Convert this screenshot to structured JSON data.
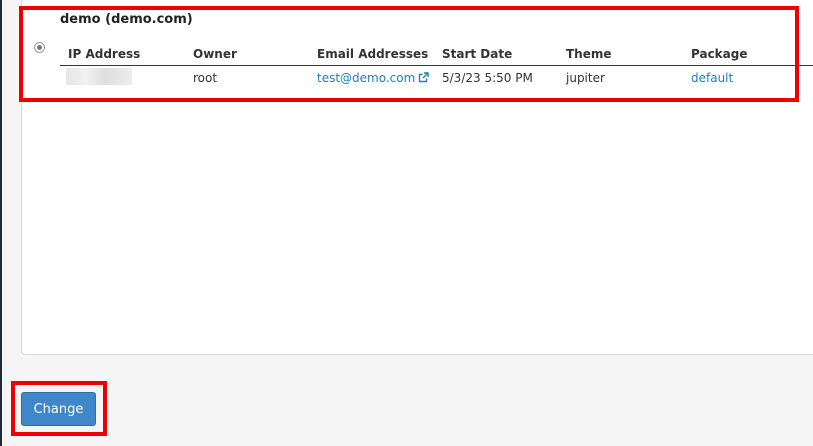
{
  "account": {
    "title": "demo (demo.com)",
    "selected": true
  },
  "table": {
    "headers": {
      "ip": "IP Address",
      "owner": "Owner",
      "email": "Email Addresses",
      "start": "Start Date",
      "theme": "Theme",
      "package": "Package"
    },
    "row": {
      "ip": "",
      "owner": "root",
      "email": "test@demo.com",
      "start": "5/3/23 5:50 PM",
      "theme": "jupiter",
      "package": "default"
    }
  },
  "actions": {
    "change_label": "Change"
  },
  "colors": {
    "link": "#1f7fc2",
    "button": "#3f87c8",
    "highlight": "#ee0000"
  },
  "icons": {
    "external_link": "external-link-icon"
  }
}
